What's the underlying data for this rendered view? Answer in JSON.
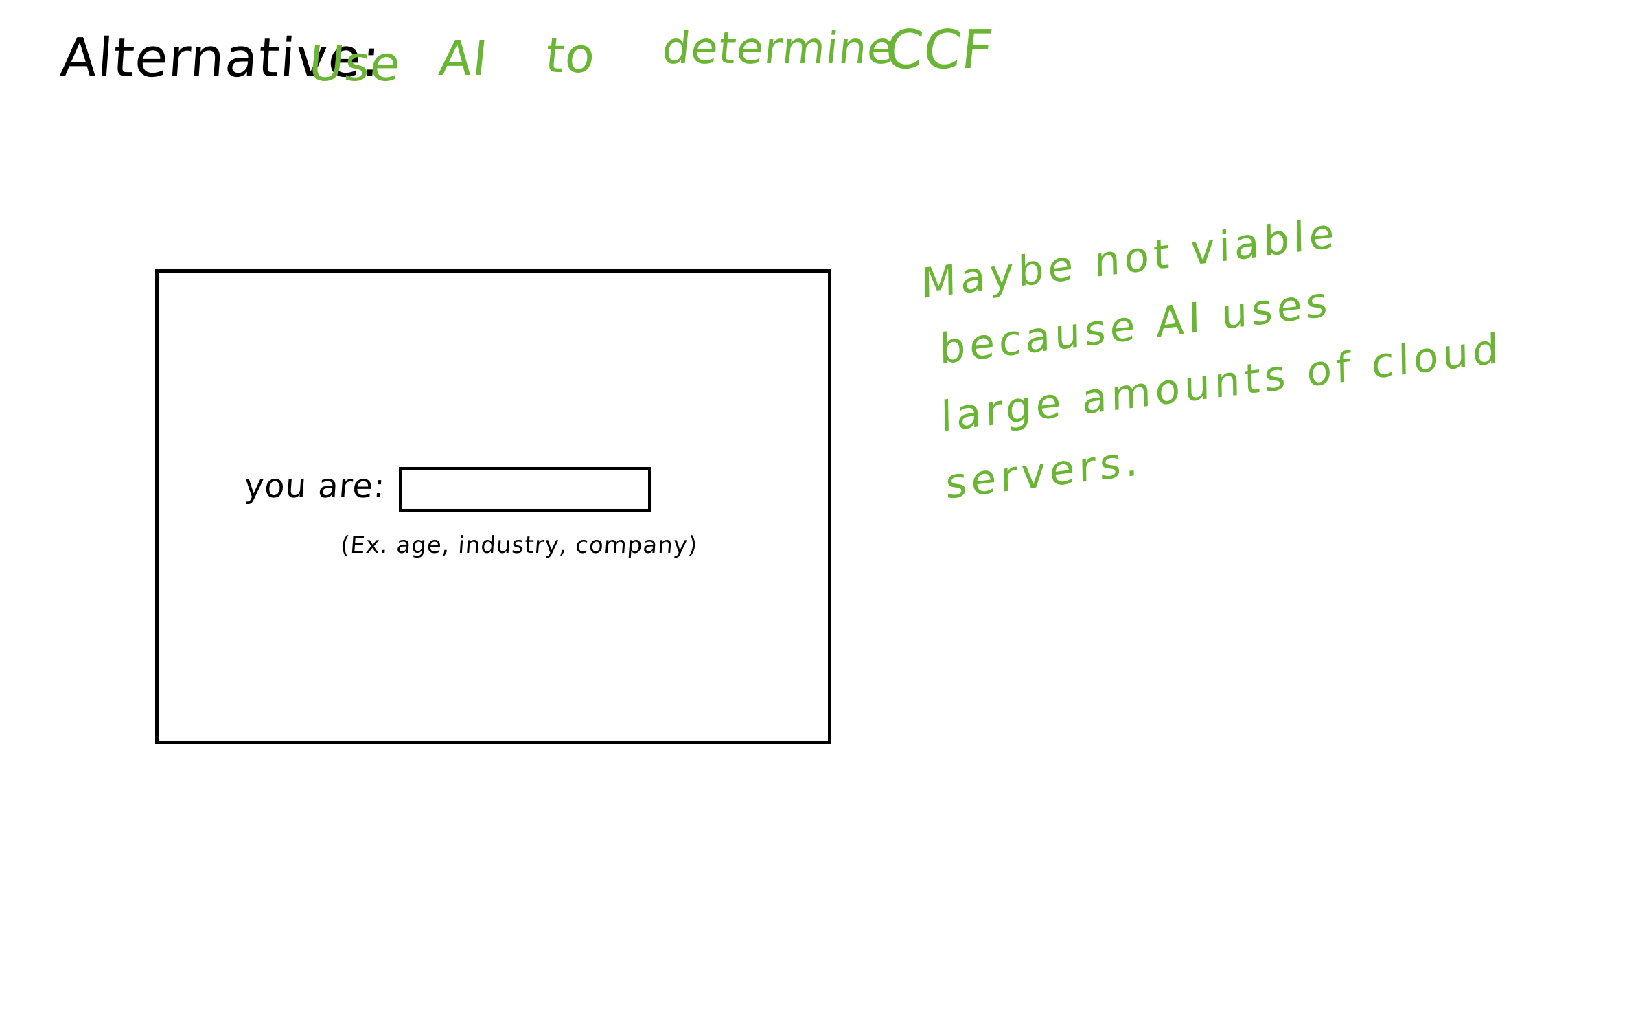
{
  "colors": {
    "ink": "#000000",
    "accent": "#6ab534",
    "background": "#ffffff"
  },
  "header": {
    "label": "Alternative:",
    "words": [
      "Use",
      "AI",
      "to",
      "determine",
      "CCF"
    ]
  },
  "mockup": {
    "field_label": "you are:",
    "input_value": "",
    "hint": "(Ex. age, industry, company)"
  },
  "note": {
    "lines": [
      "Maybe not viable",
      "because AI uses",
      "large amounts of cloud",
      "servers."
    ]
  }
}
